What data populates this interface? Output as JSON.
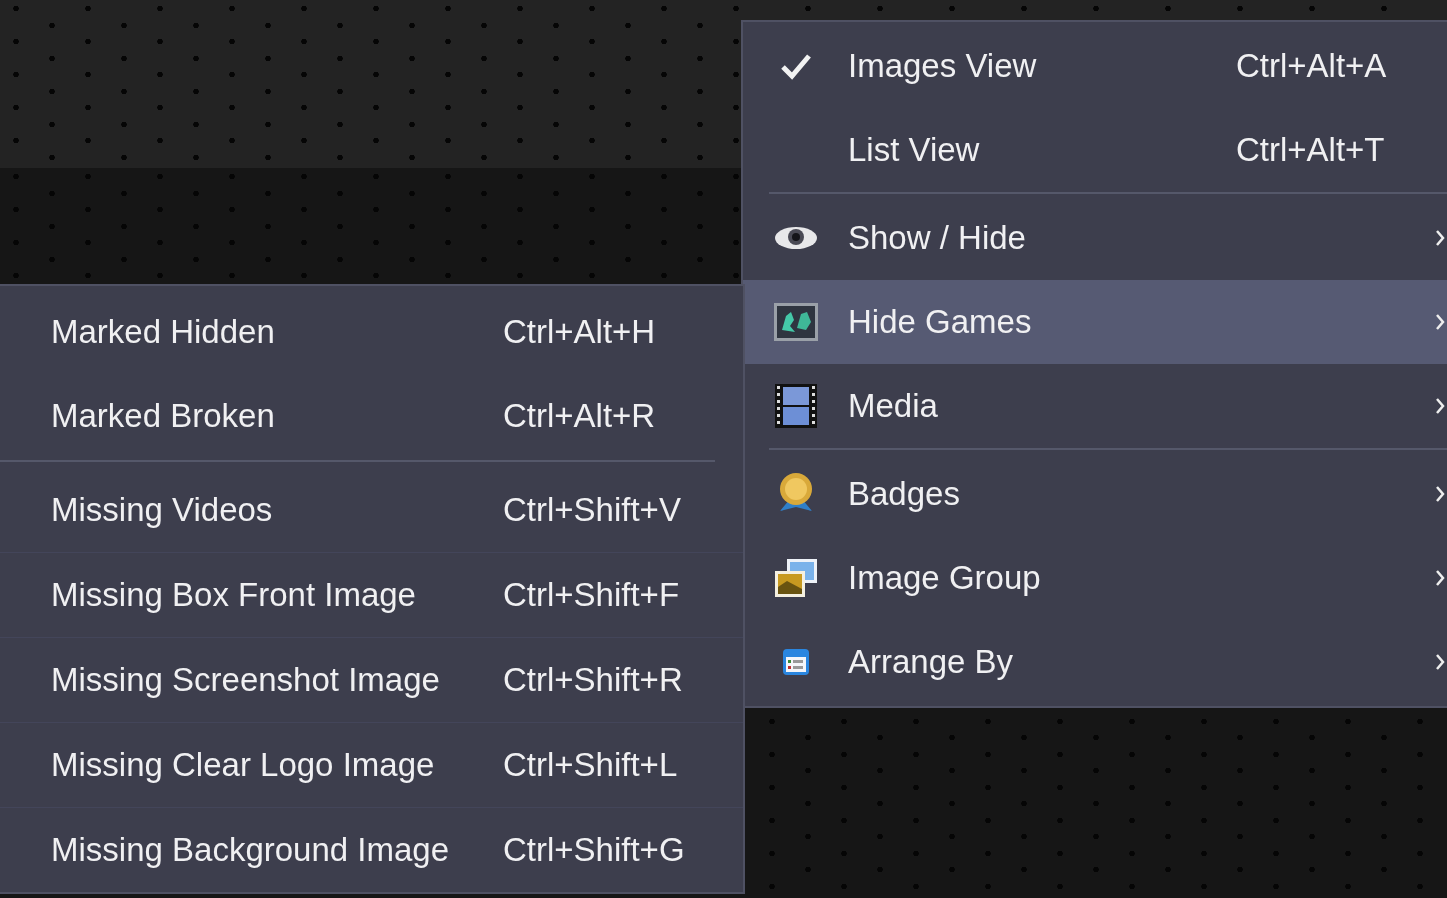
{
  "view_menu": {
    "sections": [
      [
        {
          "label": "Images View",
          "shortcut": "Ctrl+Alt+A",
          "checked": true,
          "selected": false
        },
        {
          "label": "List View",
          "shortcut": "Ctrl+Alt+T",
          "checked": false,
          "selected": false
        }
      ],
      [
        {
          "label": "Show / Hide",
          "submenu": true,
          "selected": false
        },
        {
          "label": "Hide Games",
          "submenu": true,
          "selected": true
        },
        {
          "label": "Media",
          "submenu": true,
          "selected": false
        }
      ],
      [
        {
          "label": "Badges",
          "submenu": true,
          "selected": false
        },
        {
          "label": "Image Group",
          "submenu": true,
          "selected": false
        },
        {
          "label": "Arrange By",
          "submenu": true,
          "selected": false
        }
      ]
    ]
  },
  "hide_games_submenu": {
    "sections": [
      [
        {
          "label": "Marked Hidden",
          "shortcut": "Ctrl+Alt+H"
        },
        {
          "label": "Marked Broken",
          "shortcut": "Ctrl+Alt+R"
        }
      ],
      [
        {
          "label": "Missing Videos",
          "shortcut": "Ctrl+Shift+V"
        },
        {
          "label": "Missing Box Front Image",
          "shortcut": "Ctrl+Shift+F"
        },
        {
          "label": "Missing Screenshot Image",
          "shortcut": "Ctrl+Shift+R"
        },
        {
          "label": "Missing Clear Logo Image",
          "shortcut": "Ctrl+Shift+L"
        },
        {
          "label": "Missing Background Image",
          "shortcut": "Ctrl+Shift+G"
        }
      ]
    ]
  }
}
